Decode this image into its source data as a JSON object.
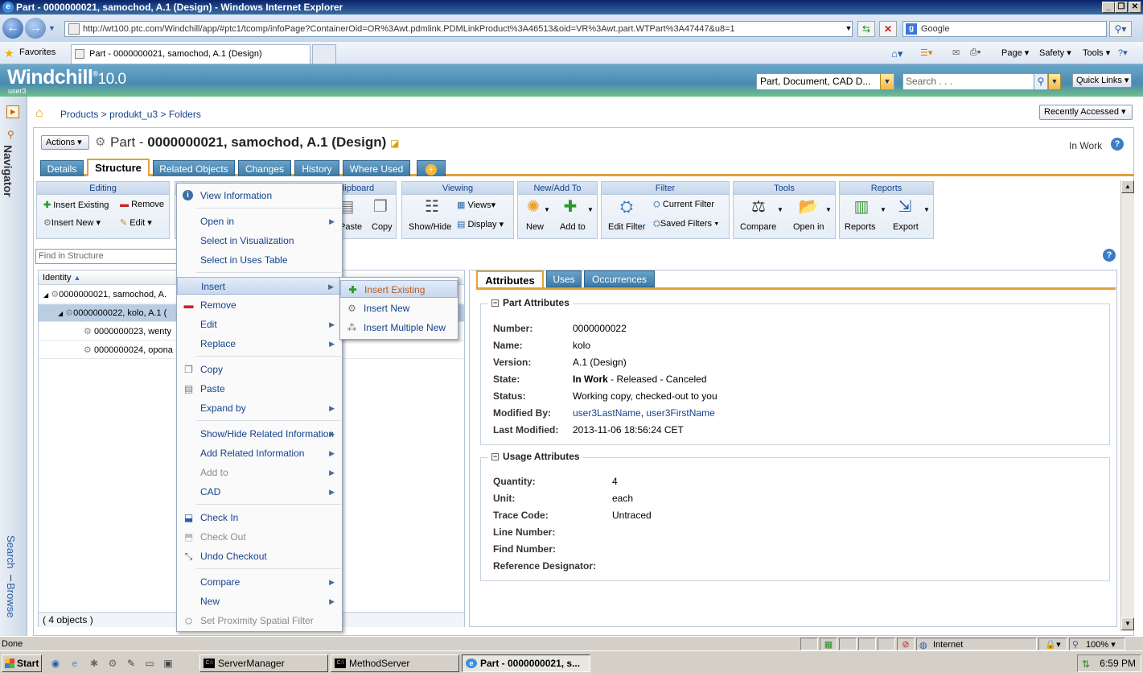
{
  "window": {
    "title": "Part - 0000000021, samochod, A.1 (Design) - Windows Internet Explorer"
  },
  "browser": {
    "address": "http://wt100.ptc.com/Windchill/app/#ptc1/tcomp/infoPage?ContainerOid=OR%3Awt.pdmlink.PDMLinkProduct%3A46513&oid=VR%3Awt.part.WTPart%3A47447&u8=1",
    "search_engine": "Google",
    "favorites_label": "Favorites",
    "tab_title": "Part - 0000000021, samochod, A.1 (Design)",
    "commands": {
      "page": "Page",
      "safety": "Safety",
      "tools": "Tools"
    }
  },
  "app": {
    "logo": "Windchill",
    "version": "10.0",
    "user": "user3",
    "type_picker": "Part, Document, CAD D...",
    "search_placeholder": "Search . . .",
    "quick_links": "Quick Links"
  },
  "leftnav": {
    "navigator": "Navigator",
    "search": "Search",
    "browse": "Browse"
  },
  "breadcrumb": [
    "Products",
    "produkt_u3",
    "Folders"
  ],
  "recently_accessed": "Recently Accessed",
  "header": {
    "actions": "Actions",
    "object_type": "Part -",
    "object_name": "0000000021, samochod, A.1 (Design)",
    "state": "In Work"
  },
  "tabs": [
    "Details",
    "Structure",
    "Related Objects",
    "Changes",
    "History",
    "Where Used"
  ],
  "toolbar": {
    "editing": {
      "title": "Editing",
      "insert_existing": "Insert Existing",
      "remove": "Remove",
      "insert_new": "Insert New",
      "edit": "Edit"
    },
    "clipboard": {
      "title": "Clipboard",
      "paste": "Paste",
      "copy": "Copy"
    },
    "viewing": {
      "title": "Viewing",
      "show_hide": "Show/Hide",
      "views": "Views",
      "display": "Display"
    },
    "new_add": {
      "title": "New/Add To",
      "new": "New",
      "add_to": "Add to"
    },
    "filter": {
      "title": "Filter",
      "edit_filter": "Edit Filter",
      "current_filter": "Current Filter",
      "saved_filters": "Saved Filters"
    },
    "tools": {
      "title": "Tools",
      "compare": "Compare",
      "open_in": "Open in"
    },
    "reports": {
      "title": "Reports",
      "reports": "Reports",
      "export": "Export"
    }
  },
  "tree": {
    "find_placeholder": "Find in Structure",
    "column": "Identity",
    "rows": [
      "0000000021, samochod, A.",
      "0000000022, kolo, A.1 (",
      "0000000023, wenty",
      "0000000024, opona"
    ],
    "count": "( 4 objects )"
  },
  "info_tabs": [
    "Attributes",
    "Uses",
    "Occurrences"
  ],
  "part_attributes": {
    "title": "Part Attributes",
    "labels": [
      "Number:",
      "Name:",
      "Version:",
      "State:",
      "Status:",
      "Modified By:",
      "Last Modified:"
    ],
    "number": "0000000022",
    "name": "kolo",
    "version": "A.1 (Design)",
    "state_current": "In Work",
    "state_rest": " - Released - Canceled",
    "status": "Working copy, checked-out to you",
    "modified_by_1": "user3LastName",
    "modified_by_sep": ", ",
    "modified_by_2": "user3FirstName",
    "last_modified": "2013-11-06 18:56:24 CET"
  },
  "usage_attributes": {
    "title": "Usage Attributes",
    "labels": [
      "Quantity:",
      "Unit:",
      "Trace Code:",
      "Line Number:",
      "Find Number:",
      "Reference Designator:"
    ],
    "quantity": "4",
    "unit": "each",
    "trace_code": "Untraced"
  },
  "context_menu": {
    "items": [
      "View Information",
      "Open in",
      "Select in Visualization",
      "Select in Uses Table",
      "Insert",
      "Remove",
      "Edit",
      "Replace",
      "Copy",
      "Paste",
      "Expand by",
      "Show/Hide Related Information",
      "Add Related Information",
      "Add to",
      "CAD",
      "Check In",
      "Check Out",
      "Undo Checkout",
      "Compare",
      "New",
      "Set Proximity Spatial Filter"
    ]
  },
  "submenu": {
    "items": [
      "Insert Existing",
      "Insert New",
      "Insert Multiple New"
    ]
  },
  "statusbar": {
    "left": "Done",
    "zone": "Internet",
    "zoom": "100%"
  },
  "taskbar": {
    "start": "Start",
    "tasks": [
      "ServerManager",
      "MethodServer",
      "Part - 0000000021, s..."
    ],
    "clock": "6:59 PM"
  }
}
